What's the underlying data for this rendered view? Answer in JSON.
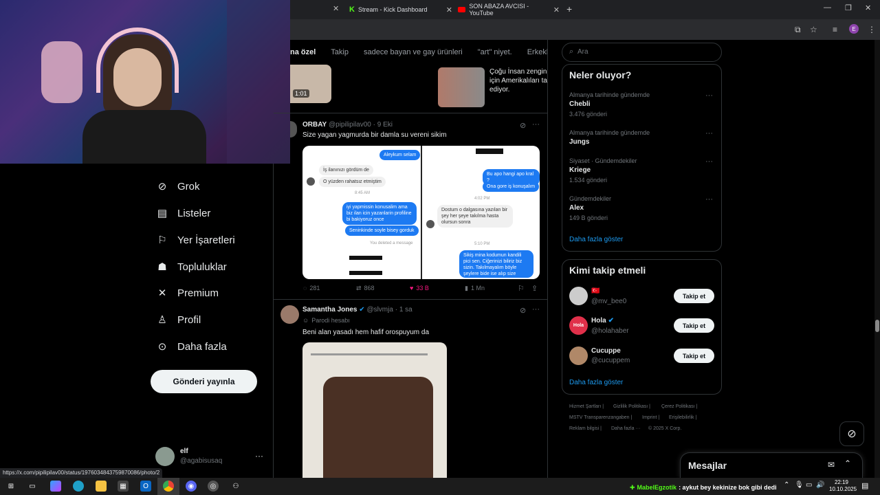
{
  "browser": {
    "tabs": [
      {
        "label": "Stream - Kick Dashboard"
      },
      {
        "label": "SON ABAZA AVCISI - YouTube"
      }
    ],
    "status_url": "https://x.com/pipilipilav00/status/1976034843759870086/photo/2"
  },
  "sidebar": {
    "items": [
      {
        "label": "Grok",
        "icon": "grok-icon"
      },
      {
        "label": "Listeler",
        "icon": "list-icon"
      },
      {
        "label": "Yer İşaretleri",
        "icon": "bookmark-icon"
      },
      {
        "label": "Topluluklar",
        "icon": "communities-icon"
      },
      {
        "label": "Premium",
        "icon": "x-logo-icon"
      },
      {
        "label": "Profil",
        "icon": "person-icon"
      },
      {
        "label": "Daha fazla",
        "icon": "more-circle-icon"
      }
    ],
    "post_button": "Gönderi yayınla",
    "account": {
      "name": "elf",
      "handle": "@agabisusaq"
    }
  },
  "feed": {
    "tabs": [
      "na özel",
      "Takip",
      "sadece bayan ve gay ürünleri",
      "\"art\" niyet.",
      "Erkeklere"
    ],
    "top_card": {
      "duration": "1:01",
      "text": "Çoğu İnsan zengin için Amerikalıları ta ediyor."
    },
    "post1": {
      "name": "ORBAY",
      "handle": "@pipilipilav00",
      "time": "· 9 Eki",
      "text": "Size yagan yagmurda bir damla su vereni sikim",
      "stats": {
        "replies": "281",
        "reposts": "868",
        "likes": "33 B",
        "views": "1 Mn"
      },
      "chat_left": {
        "bubble_top": "Aleykum selam",
        "msg1": "İş ilanınızı gördüm de",
        "msg2": "O yüzden rahatsız etmiştim",
        "time1": "8:45 AM",
        "blue1": "iyi yapmissin konusalim ama biz ilan icin yazanlarin profiline bi bakiyoruz once",
        "blue2": "Seninkinde soyle bisey gorduk",
        "deleted": "You deleted a message"
      },
      "chat_right": {
        "blue1": "Bu apo hangi apo kral ?",
        "blue2": "Ona gore iş konuşalım",
        "time1": "4:02 PM",
        "gray1": "Dostum o dalgasına yazılan bir şey her şeye takılma hasta olursun sonra",
        "time2": "5:10 PM",
        "blue3": "Sikiş mina kodumun kandili pici sen. Ciğerinizi biliriz biz sizin. Takılmayalım böyle şeylere bide ise alıp size ekmek verelim ac"
      }
    },
    "post2": {
      "name": "Samantha Jones",
      "handle": "@slvmja",
      "time": "· 1 sa",
      "label": "Parodi hesabı",
      "text": "Beni alan yasadı hem hafif orospuyum da"
    }
  },
  "right": {
    "search_placeholder": "Ara",
    "trends_title": "Neler oluyor?",
    "trends": [
      {
        "meta": "Almanya tarihinde gündemde",
        "name": "Chebli",
        "count": "3.476 gönderi"
      },
      {
        "meta": "Almanya tarihinde gündemde",
        "name": "Jungs",
        "count": ""
      },
      {
        "meta": "Siyaset · Gündemdekiler",
        "name": "Kriege",
        "count": "1.534 gönderi"
      },
      {
        "meta": "Gündemdekiler",
        "name": "Alex",
        "count": "149 B gönderi"
      }
    ],
    "show_more": "Daha fazla göster",
    "who_title": "Kimi takip etmeli",
    "who": [
      {
        "name": "🇹🇷",
        "handle": "@mv_bee0",
        "button": "Takip et"
      },
      {
        "name": "Hola",
        "handle": "@holahaber",
        "button": "Takip et",
        "avatar_text": "Hola"
      },
      {
        "name": "Cucuppe",
        "handle": "@cucuppem",
        "button": "Takip et"
      }
    ],
    "who_more": "Daha fazla göster",
    "footer": [
      "Hizmet Şartları |",
      "Gizlilik Politikası |",
      "Çerez Politikası |",
      "MSTV Transparenzangaben |",
      "Imprint |",
      "Erişilebilirlik |",
      "Reklam bilgisi |",
      "Daha fazla ···",
      "© 2025 X Corp."
    ],
    "messages": "Mesajlar"
  },
  "taskbar": {
    "ticker_user": "MabelEgzotik",
    "ticker_text": ": aykut bey kekinize bok gibi dedi",
    "time": "22:19",
    "date": "10.10.2025"
  },
  "colors": {
    "accent": "#1d9bf0",
    "like": "#f91880",
    "kick": "#53fc18",
    "youtube": "#ff0000"
  }
}
